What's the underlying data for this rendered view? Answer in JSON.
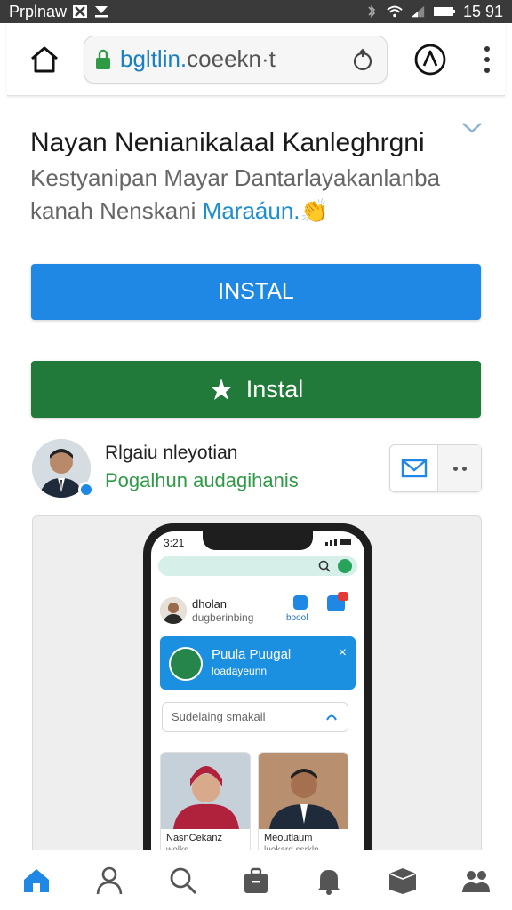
{
  "status_bar": {
    "carrier": "Prplnaw",
    "time": "15 91"
  },
  "browser": {
    "url_host": "bgltlin.",
    "url_domain": "coeekn·t"
  },
  "promo": {
    "title": "Nayan Nenianikalaal Kanleghrgni",
    "description": "Kestyanipan Mayar Dantarlayakanlanba kanah Nenskani ",
    "description_link": "Maraáun.",
    "emoji": "👏"
  },
  "buttons": {
    "primary_label": "INSTAL",
    "secondary_label": "Instal"
  },
  "profile": {
    "name": "Rlgaiu nleyotian",
    "subtitle": "Pogalhun audagihanis"
  },
  "preview": {
    "phone_time": "3:21",
    "user_name": "dholan",
    "user_sub": "dugberinbing",
    "icon_label": "boool",
    "card_title": "Puula Puugal",
    "card_sub": "loadayeunn",
    "card_close": "×",
    "input_placeholder": "Sudelaing smakail",
    "tiles": [
      {
        "name": "NasnCekanz",
        "sub": "wolks"
      },
      {
        "name": "Meoutlaum",
        "sub": "luokard ssrkln"
      }
    ]
  },
  "colors": {
    "primary": "#1f88e4",
    "secondary": "#227a3a",
    "link": "#1d8fcf",
    "status_bar": "#3a3a3a"
  },
  "bottom_nav": [
    "home-icon",
    "profile-icon",
    "search-icon",
    "briefcase-icon",
    "bell-icon",
    "box-icon",
    "people-icon"
  ]
}
